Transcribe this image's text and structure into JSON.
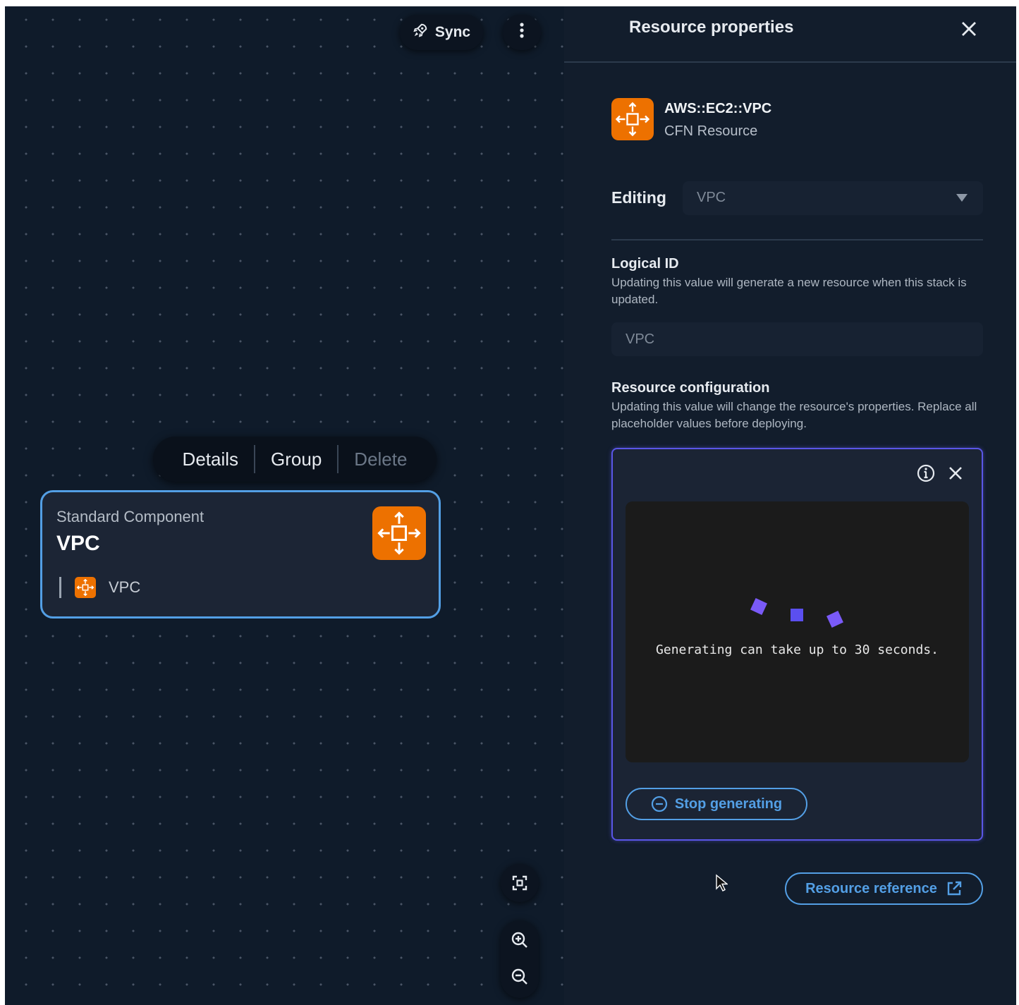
{
  "toolbar": {
    "sync_label": "Sync",
    "sync_icon": "rocket-icon",
    "more_icon": "vertical-ellipsis-icon"
  },
  "context_menu": {
    "items": [
      {
        "label": "Details",
        "enabled": true
      },
      {
        "label": "Group",
        "enabled": true
      },
      {
        "label": "Delete",
        "enabled": false
      }
    ]
  },
  "node": {
    "subtitle": "Standard Component",
    "title": "VPC",
    "child_label": "VPC",
    "icon": "vpc-icon"
  },
  "canvas_controls": {
    "fit_icon": "fit-view-icon",
    "zoom_in_icon": "zoom-in-icon",
    "zoom_out_icon": "zoom-out-icon"
  },
  "panel": {
    "title": "Resource properties",
    "close_icon": "close-icon",
    "resource_type": "AWS::EC2::VPC",
    "resource_kind": "CFN Resource",
    "editing_label": "Editing",
    "editing_value": "VPC",
    "logical_id": {
      "title": "Logical ID",
      "description": "Updating this value will generate a new resource when this stack is updated.",
      "value": "VPC"
    },
    "resource_configuration": {
      "title": "Resource configuration",
      "description": "Updating this value will change the resource's properties. Replace all placeholder values before deploying."
    },
    "generation": {
      "message": "Generating can take up to 30 seconds.",
      "stop_label": "Stop generating",
      "info_icon": "info-icon"
    },
    "reference_label": "Resource reference",
    "reference_icon": "external-link-icon"
  },
  "colors": {
    "accent": "#539fe5",
    "aws_orange": "#ed7100",
    "generation_border": "#5a56e6"
  }
}
